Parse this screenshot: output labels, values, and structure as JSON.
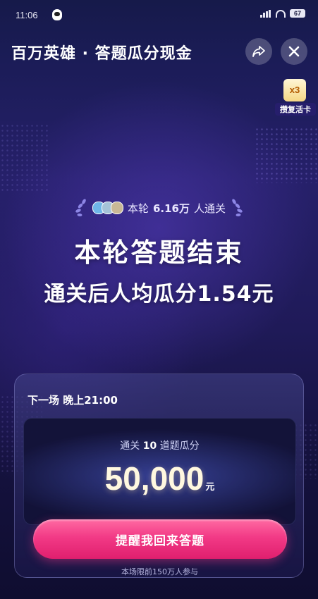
{
  "status_bar": {
    "time": "11:06",
    "battery": "67"
  },
  "header": {
    "title": "百万英雄 · 答题瓜分现金",
    "share_icon": "share-icon",
    "close_icon": "close-icon"
  },
  "card_badge": {
    "count": "x3",
    "label": "攒复活卡"
  },
  "result": {
    "passed_prefix": "本轮",
    "passed_count": "6.16万",
    "passed_suffix": "人通关",
    "headline": "本轮答题结束",
    "per_person": "通关后人均瓜分1.54元"
  },
  "next_game": {
    "label": "下一场 晚上21:00",
    "prize_prefix": "通关",
    "prize_questions": "10",
    "prize_suffix": "道题瓜分",
    "prize_value": "50,000",
    "prize_unit": "元",
    "remind_button": "提醒我回来答题",
    "limit_note": "本场限前150万人参与"
  },
  "colors": {
    "background_top": "#161a4a",
    "background_mid": "#26206a",
    "button_pink": "#f23a86"
  }
}
